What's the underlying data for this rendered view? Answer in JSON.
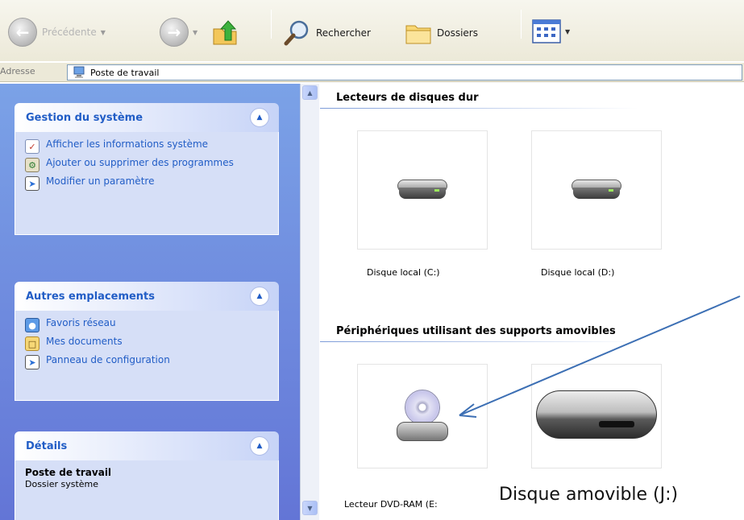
{
  "toolbar": {
    "back_label": "Précédente",
    "search_label": "Rechercher",
    "folders_label": "Dossiers"
  },
  "address": {
    "label": "Adresse",
    "value": "Poste de travail"
  },
  "left_pane": {
    "system_tasks": {
      "title": "Gestion du système",
      "items": [
        {
          "label": "Afficher les informations système",
          "icon": "system-info-icon"
        },
        {
          "label": "Ajouter ou supprimer des programmes",
          "icon": "add-remove-programs-icon"
        },
        {
          "label": "Modifier un paramètre",
          "icon": "control-panel-icon"
        }
      ]
    },
    "other_places": {
      "title": "Autres emplacements",
      "items": [
        {
          "label": "Favoris réseau",
          "icon": "network-places-icon"
        },
        {
          "label": "Mes documents",
          "icon": "my-documents-icon"
        },
        {
          "label": "Panneau de configuration",
          "icon": "control-panel-icon"
        }
      ]
    },
    "details": {
      "title": "Détails",
      "name": "Poste de travail",
      "type": "Dossier système"
    }
  },
  "content": {
    "hard_drives": {
      "title": "Lecteurs de disques dur",
      "items": [
        "Disque local (C:)",
        "Disque local (D:)"
      ]
    },
    "removable": {
      "title": "Périphériques utilisant des supports amovibles",
      "items": [
        "Lecteur DVD-RAM (E:",
        "Disque amovible (J:)"
      ]
    }
  },
  "colors": {
    "task_pane_top": "#7ba2e7",
    "task_pane_bottom": "#6375d6",
    "link_blue": "#215dc6",
    "arrow": "#3c6fb4"
  }
}
